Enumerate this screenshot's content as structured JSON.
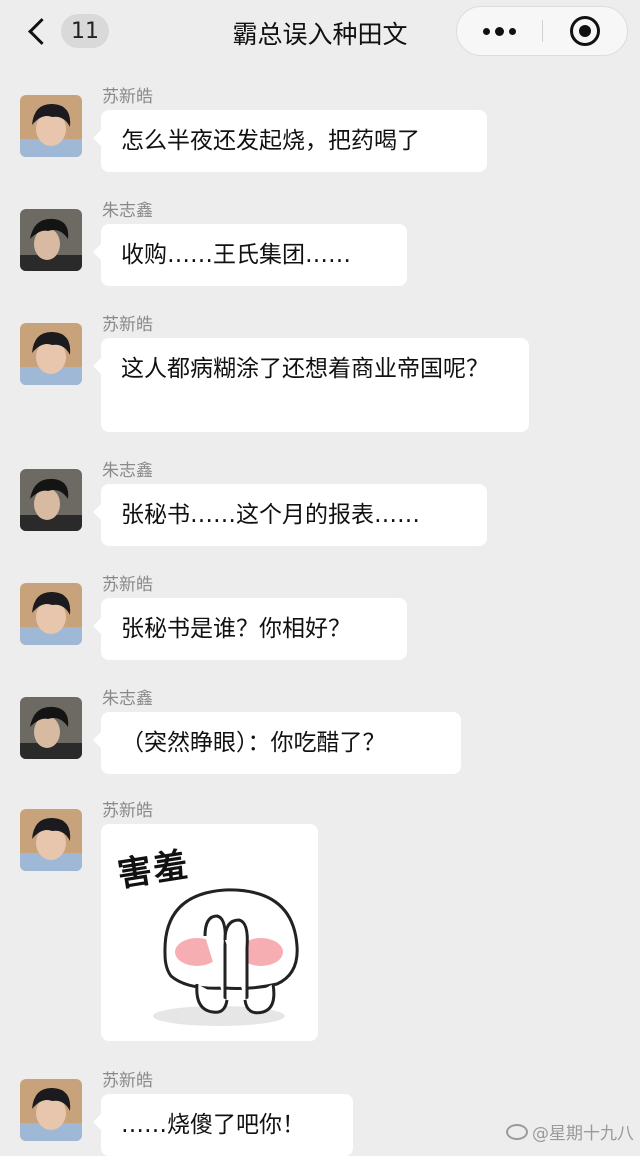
{
  "header": {
    "back_icon": "chevron-left-icon",
    "unread_count": "11",
    "title": "霸总误入种田文",
    "more_icon": "more-dots-icon",
    "close_icon": "target-circle-icon"
  },
  "messages": [
    {
      "sender": "苏新皓",
      "text": "怎么半夜还发起烧，把药喝了"
    },
    {
      "sender": "朱志鑫",
      "text": "收购……王氏集团……"
    },
    {
      "sender": "苏新皓",
      "text": "这人都病糊涂了还想着商业帝国呢？"
    },
    {
      "sender": "朱志鑫",
      "text": "张秘书……这个月的报表……"
    },
    {
      "sender": "苏新皓",
      "text": "张秘书是谁？你相好？"
    },
    {
      "sender": "朱志鑫",
      "text": "（突然睁眼）：你吃醋了？"
    },
    {
      "sender": "苏新皓",
      "sticker_text": "害羞",
      "sticker_icon": "shy-bunny-sticker"
    },
    {
      "sender": "苏新皓",
      "text": "……烧傻了吧你！"
    }
  ],
  "watermark": {
    "text": "@星期十九八",
    "icon": "weibo-icon"
  },
  "colors": {
    "background": "#ededed",
    "bubble": "#ffffff",
    "sender_name": "#8a8a8a",
    "blush": "#f4a0a6"
  }
}
